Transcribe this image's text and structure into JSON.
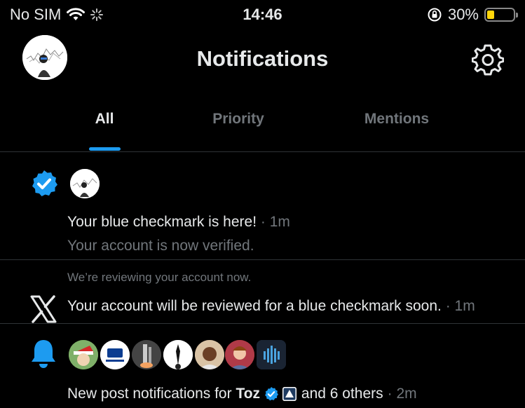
{
  "status_bar": {
    "carrier": "No SIM",
    "time": "14:46",
    "battery": "30%",
    "battery_level": 0.3
  },
  "header": {
    "title": "Notifications",
    "avatar_icon": "profile-avatar",
    "settings_icon": "gear-icon"
  },
  "tabs": [
    {
      "label": "All",
      "active": true
    },
    {
      "label": "Priority",
      "active": false
    },
    {
      "label": "Mentions",
      "active": false
    }
  ],
  "notifications": [
    {
      "icon": "verified-badge-icon",
      "title": "Your blue checkmark is here!",
      "time": "· 1m",
      "subtitle": "Your account is now verified."
    },
    {
      "icon": "x-logo-icon",
      "preface": "We’re reviewing your account now.",
      "title": "Your account will be reviewed for a blue checkmark soon.",
      "time": "· 1m"
    },
    {
      "icon": "bell-icon",
      "text_prefix": "New post notifications for ",
      "name": "Toz",
      "text_suffix": " and 6 others",
      "time": "· 2m"
    }
  ],
  "colors": {
    "accent": "#1d9bf0",
    "background": "#000000",
    "muted": "#71767b"
  }
}
